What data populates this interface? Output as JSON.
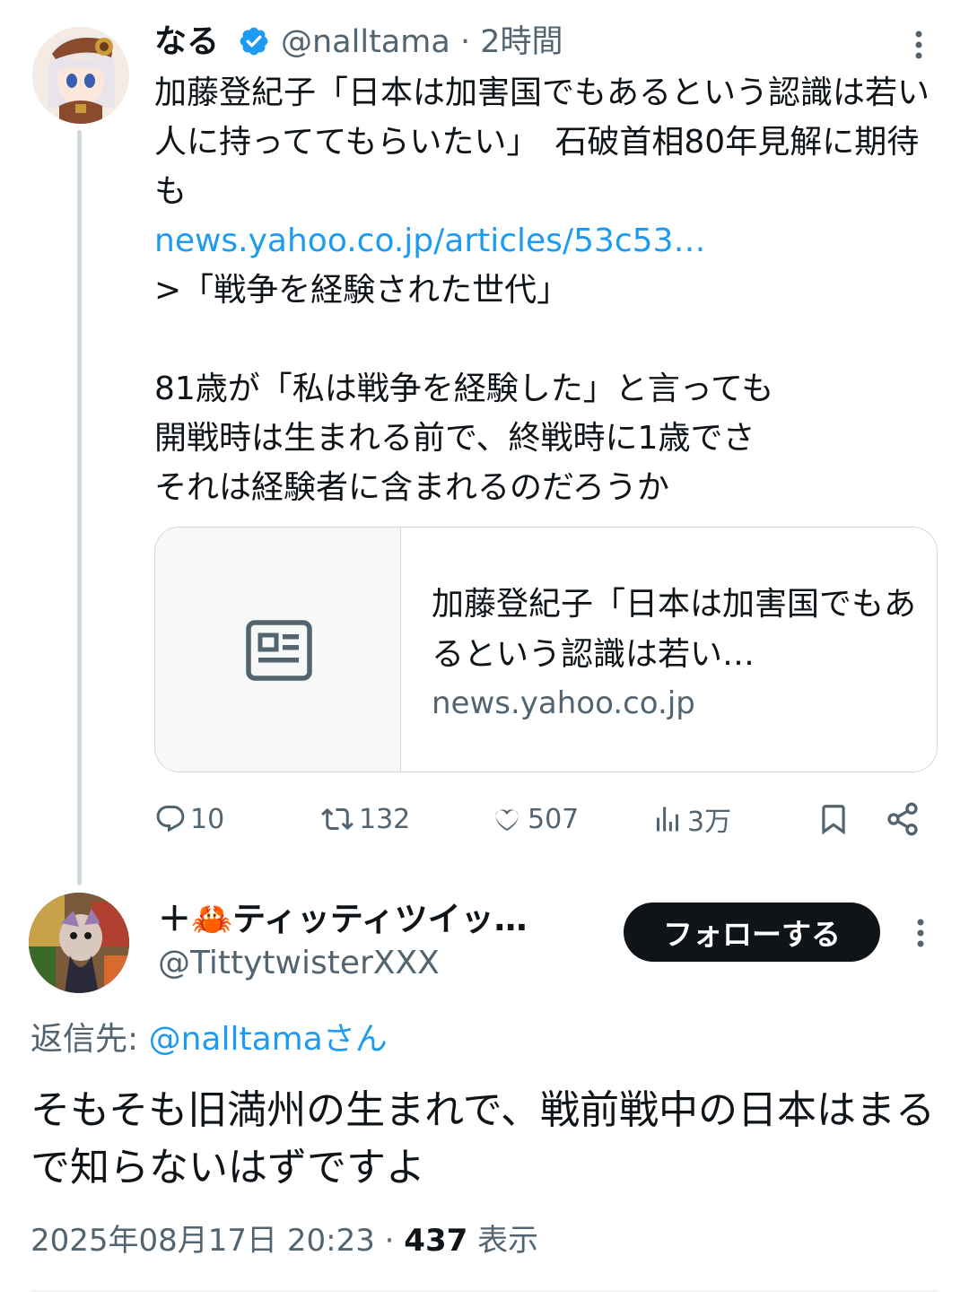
{
  "tweet": {
    "author_name": "なる",
    "handle": "@nalltama",
    "time_sep": "·",
    "time": "2時間",
    "text_before_link": "加藤登紀子「日本は加害国でもあるという認識は若い人に持っててもらいたい」　石破首相80年見解に期待も\n",
    "link": "news.yahoo.co.jp/articles/53c53…",
    "text_after_link": "\n>「戦争を経験された世代」\n\n81歳が「私は戦争を経験した」と言っても\n開戦時は生まれる前で、終戦時に1歳でさ\nそれは経験者に含まれるのだろうか",
    "card": {
      "icon": "newspaper-icon",
      "title": "加藤登紀子「日本は加害国でもあるという認識は若い…",
      "domain": "news.yahoo.co.jp"
    },
    "actions": {
      "replies": "10",
      "retweets": "132",
      "likes": "507",
      "views": "3万"
    }
  },
  "reply": {
    "author_name": "＋🦀ティッティツイッ…",
    "handle": "@TittytwisterXXX",
    "follow_label": "フォローする",
    "reply_to_label": "返信先: ",
    "reply_to_mention": "@nalltamaさん",
    "text": "そもそも旧満州の生まれで、戦前戦中の日本はまるで知らないはずですよ",
    "timestamp": "2025年08月17日 20:23",
    "meta_sep": " · ",
    "views_count": "437",
    "views_label": " 表示"
  },
  "colors": {
    "link": "#1d9bf0",
    "secondary_text": "#536471",
    "verified": "#1d9bf0",
    "follow_button": "#0f1419"
  }
}
